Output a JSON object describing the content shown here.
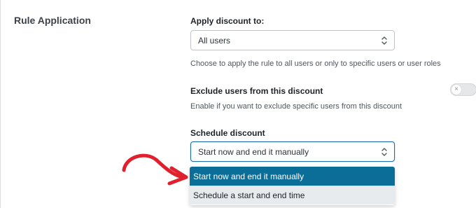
{
  "section": {
    "title": "Rule Application"
  },
  "apply_discount": {
    "label": "Apply discount to:",
    "selected": "All users",
    "help": "Choose to apply the rule to all users or only to specific users or user roles"
  },
  "exclude_users": {
    "label": "Exclude users from this discount",
    "help": "Enable if you want to exclude specific users from this discount",
    "toggle_on": false,
    "toggle_icon": "×"
  },
  "schedule": {
    "label": "Schedule discount",
    "selected": "Start now and end it manually",
    "options": [
      "Start now and end it manually",
      "Schedule a start and end time"
    ]
  },
  "colors": {
    "accent": "#0a6e99",
    "arrow": "#e0202d"
  }
}
